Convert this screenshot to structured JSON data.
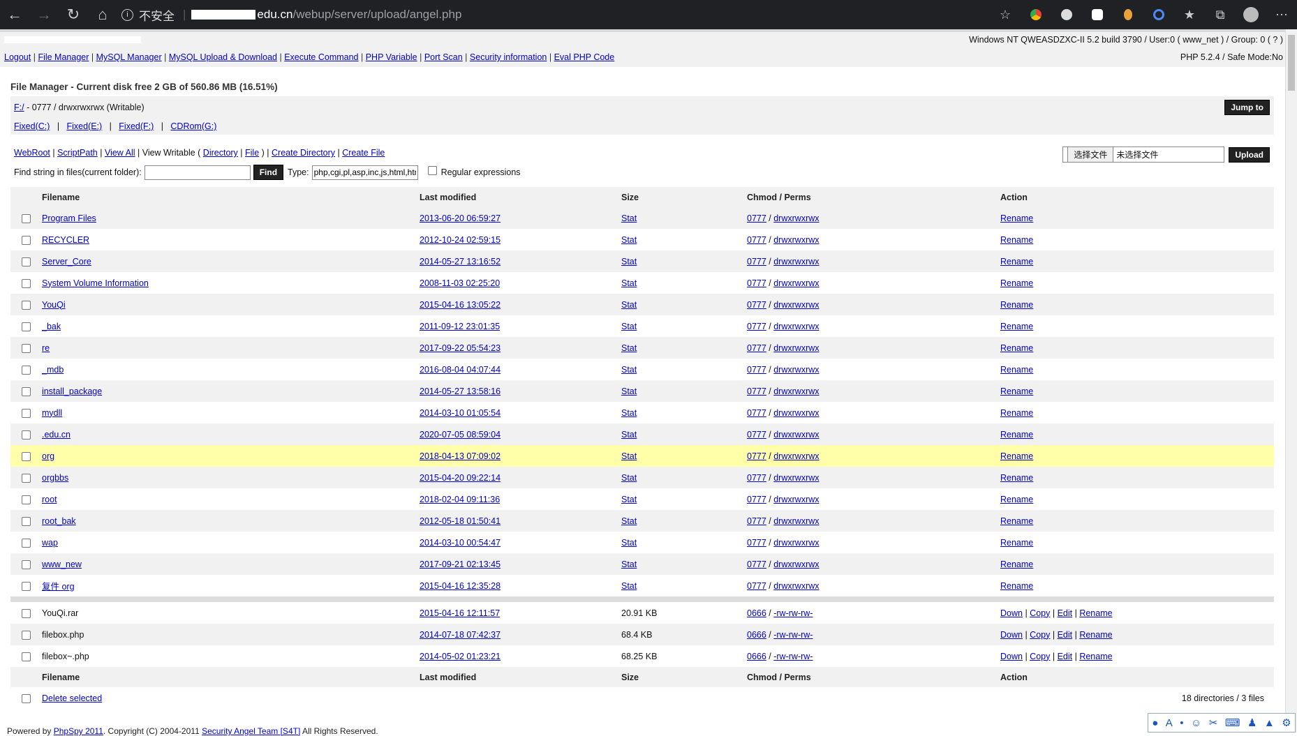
{
  "browser": {
    "security_label": "不安全",
    "url_host": "edu.cn",
    "url_path": "/webup/server/upload/angel.php"
  },
  "sysinfo": {
    "right": "Windows NT QWEASDZXC-II 5.2 build 3790 / User:0 ( www_net ) / Group: 0 ( ? )"
  },
  "menu": {
    "items": [
      "Logout",
      "File Manager",
      "MySQL Manager",
      "MySQL Upload & Download",
      "Execute Command",
      "PHP Variable",
      "Port Scan",
      "Security information",
      "Eval PHP Code"
    ],
    "right": "PHP 5.2.4 / Safe Mode:No"
  },
  "file_manager": {
    "title": "File Manager - Current disk free 2 GB of 560.86 MB (16.51%)",
    "path_link": "F:/",
    "path_info": " - 0777 / drwxrwxrwx (Writable)",
    "jump_label": "Jump to",
    "drives": [
      "Fixed(C:)",
      "Fixed(E:)",
      "Fixed(F:)",
      "CDRom(G:)"
    ]
  },
  "tools": {
    "webroot": "WebRoot",
    "scriptpath": "ScriptPath",
    "view_all": "View All",
    "view_writable": "View Writable (",
    "directory": "Directory",
    "file": "File",
    "close_paren": ")",
    "create_directory": "Create Directory",
    "create_file": "Create File",
    "find_label": "Find string in files(current folder):",
    "find_value": "",
    "find_button": "Find",
    "type_label": "Type:",
    "type_value": "php,cgi,pl,asp,inc,js,html,htm",
    "regex_label": "Regular expressions",
    "choose_file": "选择文件",
    "no_file": "未选择文件",
    "upload_label": "Upload"
  },
  "table": {
    "headers": [
      "Filename",
      "Last modified",
      "Size",
      "Chmod / Perms",
      "Action"
    ],
    "stat": "Stat",
    "rename": "Rename",
    "dirs": [
      {
        "name": "Program Files",
        "date": "2013-06-20 06:59:27",
        "chmod": "0777",
        "perms": "drwxrwxrwx"
      },
      {
        "name": "RECYCLER",
        "date": "2012-10-24 02:59:15",
        "chmod": "0777",
        "perms": "drwxrwxrwx"
      },
      {
        "name": "Server_Core",
        "date": "2014-05-27 13:16:52",
        "chmod": "0777",
        "perms": "drwxrwxrwx"
      },
      {
        "name": "System Volume Information",
        "date": "2008-11-03 02:25:20",
        "chmod": "0777",
        "perms": "drwxrwxrwx"
      },
      {
        "name": "YouQi",
        "date": "2015-04-16 13:05:22",
        "chmod": "0777",
        "perms": "drwxrwxrwx"
      },
      {
        "name": "_bak",
        "date": "2011-09-12 23:01:35",
        "chmod": "0777",
        "perms": "drwxrwxrwx"
      },
      {
        "name": "re",
        "date": "2017-09-22 05:54:23",
        "chmod": "0777",
        "perms": "drwxrwxrwx"
      },
      {
        "name": "_mdb",
        "date": "2016-08-04 04:07:44",
        "chmod": "0777",
        "perms": "drwxrwxrwx"
      },
      {
        "name": "install_package",
        "date": "2014-05-27 13:58:16",
        "chmod": "0777",
        "perms": "drwxrwxrwx"
      },
      {
        "name": "mydll",
        "date": "2014-03-10 01:05:54",
        "chmod": "0777",
        "perms": "drwxrwxrwx"
      },
      {
        "name": ".edu.cn",
        "date": "2020-07-05 08:59:04",
        "chmod": "0777",
        "perms": "drwxrwxrwx"
      },
      {
        "name": "org",
        "date": "2018-04-13 07:09:02",
        "chmod": "0777",
        "perms": "drwxrwxrwx"
      },
      {
        "name": "orgbbs",
        "date": "2015-04-20 09:22:14",
        "chmod": "0777",
        "perms": "drwxrwxrwx"
      },
      {
        "name": "root",
        "date": "2018-02-04 09:11:36",
        "chmod": "0777",
        "perms": "drwxrwxrwx"
      },
      {
        "name": "root_bak",
        "date": "2012-05-18 01:50:41",
        "chmod": "0777",
        "perms": "drwxrwxrwx"
      },
      {
        "name": "wap",
        "date": "2014-03-10 00:54:47",
        "chmod": "0777",
        "perms": "drwxrwxrwx"
      },
      {
        "name": "www_new",
        "date": "2017-09-21 02:13:45",
        "chmod": "0777",
        "perms": "drwxrwxrwx"
      },
      {
        "name": "复件 org",
        "date": "2015-04-16 12:35:28",
        "chmod": "0777",
        "perms": "drwxrwxrwx"
      }
    ],
    "files": [
      {
        "name": "YouQi.rar",
        "date": "2015-04-16 12:11:57",
        "size": "20.91 KB",
        "chmod": "0666",
        "perms": "-rw-rw-rw-"
      },
      {
        "name": "filebox.php",
        "date": "2014-07-18 07:42:37",
        "size": "68.4 KB",
        "chmod": "0666",
        "perms": "-rw-rw-rw-"
      },
      {
        "name": "filebox~.php",
        "date": "2014-05-02 01:23:21",
        "size": "68.25 KB",
        "chmod": "0666",
        "perms": "-rw-rw-rw-"
      }
    ],
    "file_actions": [
      "Down",
      "Copy",
      "Edit",
      "Rename"
    ],
    "delete_selected": "Delete selected",
    "summary": "18 directories / 3 files"
  },
  "footer": {
    "powered": "Powered by",
    "phpspy": "PhpSpy 2011",
    "copyright": ". Copyright (C) 2004-2011",
    "team": "Security Angel Team [S4T]",
    "rights": "All Rights Reserved."
  },
  "highlight_color": "#ffffaa"
}
